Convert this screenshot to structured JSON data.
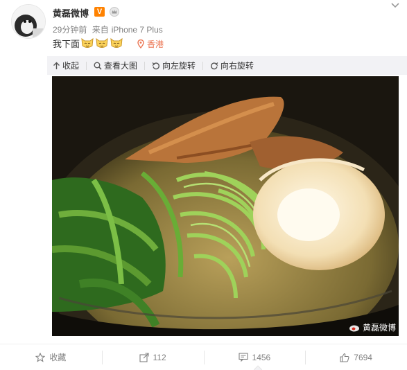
{
  "post": {
    "username": "黄磊微博",
    "verified_badge": "V",
    "timestamp": "29分钟前",
    "source_prefix": "来自",
    "source": "iPhone 7 Plus",
    "text": "我下面",
    "emojis": [
      "cat-face-emoji",
      "cat-face-emoji",
      "cat-face-emoji"
    ],
    "location": "香港"
  },
  "toolbar": {
    "collapse": "收起",
    "view_large": "查看大图",
    "rotate_left": "向左旋转",
    "rotate_right": "向右旋转"
  },
  "image": {
    "description_icon": "noodle-soup-photo",
    "watermark": "黄磊微博"
  },
  "actions": {
    "favorite": "收藏",
    "repost": "112",
    "comment": "1456",
    "like": "7694"
  },
  "colors": {
    "accent": "#eb7350",
    "badge": "#ff8200",
    "muted": "#808080",
    "toolbar_bg": "#f2f2f5"
  }
}
